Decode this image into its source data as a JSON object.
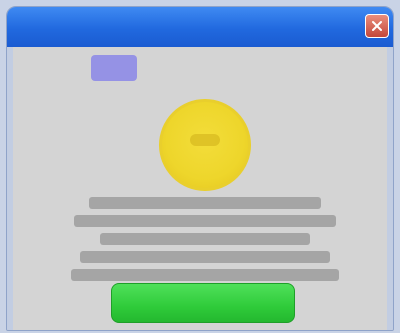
{
  "window": {
    "title": ""
  },
  "dialog": {
    "message": "",
    "button_label": ""
  },
  "colors": {
    "titlebar": "#2169df",
    "background": "#d4d4d4",
    "coin": "#eed62b",
    "button": "#2fcb3a",
    "close": "#c4473a",
    "tab": "#8a86e8"
  },
  "icons": {
    "close": "close-icon",
    "coin": "coin-icon"
  }
}
